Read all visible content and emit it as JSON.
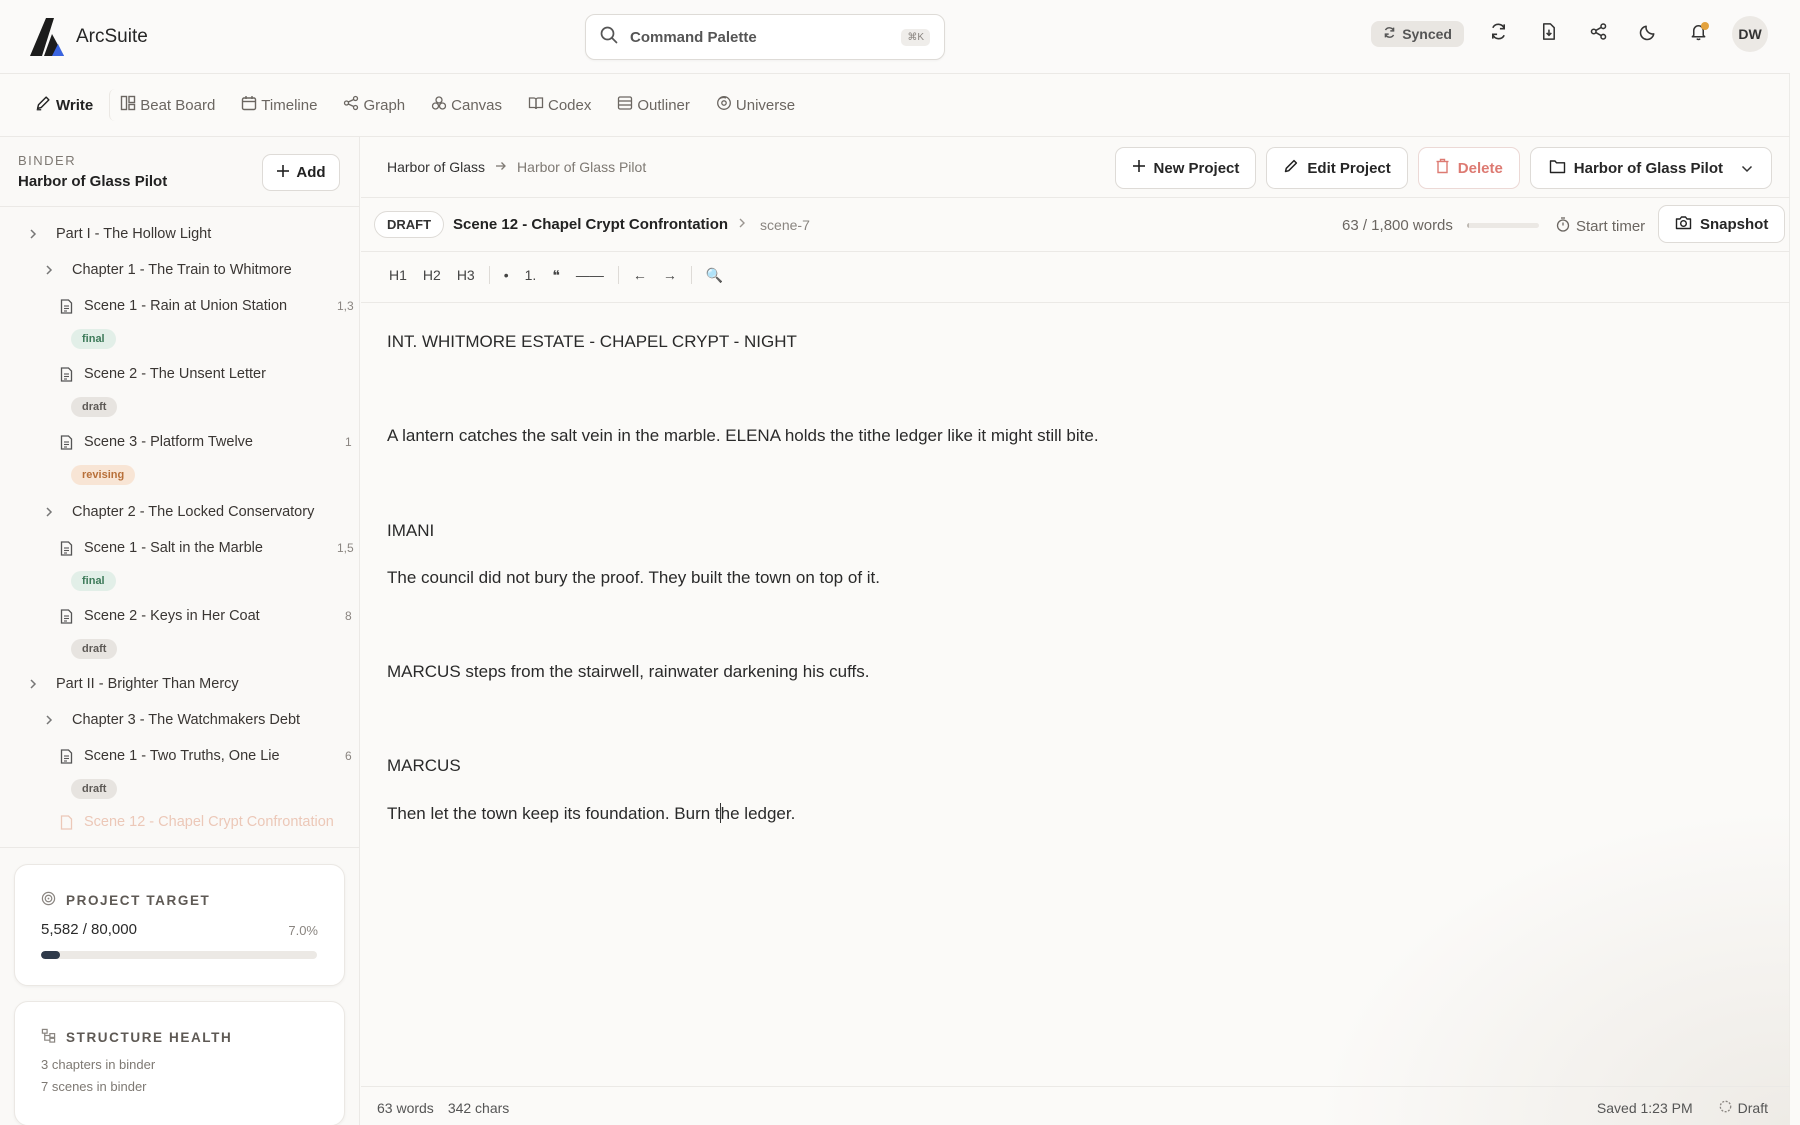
{
  "app": {
    "name": "ArcSuite"
  },
  "command": {
    "placeholder": "Command Palette",
    "shortcut": "⌘K"
  },
  "header": {
    "sync_label": "Synced",
    "avatar_initials": "DW"
  },
  "tabs": [
    {
      "label": "Write",
      "icon": "pen-icon"
    },
    {
      "label": "Beat Board",
      "icon": "board-icon"
    },
    {
      "label": "Timeline",
      "icon": "calendar-icon"
    },
    {
      "label": "Graph",
      "icon": "graph-icon"
    },
    {
      "label": "Canvas",
      "icon": "canvas-icon"
    },
    {
      "label": "Codex",
      "icon": "book-icon"
    },
    {
      "label": "Outliner",
      "icon": "outline-icon"
    },
    {
      "label": "Universe",
      "icon": "universe-icon"
    }
  ],
  "binder": {
    "label": "BINDER",
    "project": "Harbor of Glass Pilot",
    "add_label": "Add",
    "items": [
      {
        "type": "part",
        "label": "Part I - The Hollow Light"
      },
      {
        "type": "chapter",
        "label": "Chapter 1 - The Train to Whitmore"
      },
      {
        "type": "scene",
        "label": "Scene 1 - Rain at Union Station",
        "count": "1,3",
        "status": "final"
      },
      {
        "type": "scene",
        "label": "Scene 2 - The Unsent Letter",
        "count": "",
        "status": "draft"
      },
      {
        "type": "scene",
        "label": "Scene 3 - Platform Twelve",
        "count": "1",
        "status": "revising"
      },
      {
        "type": "chapter",
        "label": "Chapter 2 - The Locked Conservatory"
      },
      {
        "type": "scene",
        "label": "Scene 1 - Salt in the Marble",
        "count": "1,5",
        "status": "final"
      },
      {
        "type": "scene",
        "label": "Scene 2 - Keys in Her Coat",
        "count": "8",
        "status": "draft"
      },
      {
        "type": "part",
        "label": "Part II - Brighter Than Mercy"
      },
      {
        "type": "chapter",
        "label": "Chapter 3 - The Watchmakers Debt"
      },
      {
        "type": "scene",
        "label": "Scene 1 - Two Truths, One Lie",
        "count": "6",
        "status": "draft"
      }
    ],
    "faded_item": "Scene 12 - Chapel Crypt Confrontation"
  },
  "project_target": {
    "title": "PROJECT TARGET",
    "value": "5,582 / 80,000",
    "percent_label": "7.0%",
    "progress": 0.07
  },
  "structure_health": {
    "title": "STRUCTURE HEALTH",
    "line1": "3 chapters in binder",
    "line2": "7 scenes in binder"
  },
  "breadcrumb": {
    "part1": "Harbor of Glass",
    "part2": "Harbor of Glass Pilot"
  },
  "actions": {
    "new_project": "New Project",
    "edit_project": "Edit Project",
    "delete": "Delete",
    "project_select": "Harbor of Glass Pilot"
  },
  "scene": {
    "status": "DRAFT",
    "title": "Scene 12 - Chapel Crypt Confrontation",
    "id": "scene-7",
    "words": "63 / 1,800 words",
    "word_progress": 0.035,
    "timer": "Start timer",
    "snapshot": "Snapshot"
  },
  "toolbar": {
    "h1": "H1",
    "h2": "H2",
    "h3": "H3",
    "bullet": "•",
    "numbered": "1.",
    "quote": "❝",
    "rule": "——",
    "undo": "←",
    "redo": "→",
    "search": "🔍"
  },
  "editor": {
    "p1": "INT. WHITMORE ESTATE - CHAPEL CRYPT - NIGHT",
    "p2": "A lantern catches the salt vein in the marble. ELENA holds the tithe ledger like it might still bite.",
    "p3": "IMANI",
    "p4": "The council did not bury the proof. They built the town on top of it.",
    "p5": "MARCUS steps from the stairwell, rainwater darkening his cuffs.",
    "p6": "MARCUS",
    "p7a": "Then let the town keep its foundation. Burn t",
    "p7b": "he ledger."
  },
  "status": {
    "words": "63 words",
    "chars": "342 chars",
    "saved": "Saved 1:23 PM",
    "state": "Draft"
  }
}
